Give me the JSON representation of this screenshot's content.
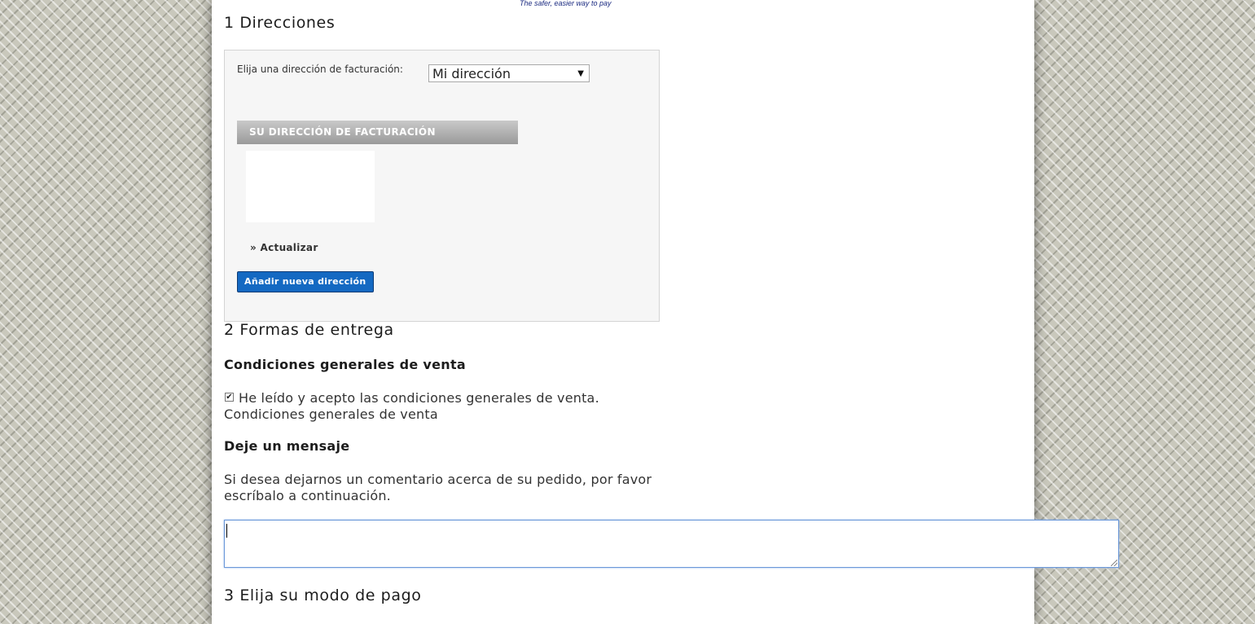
{
  "header": {
    "paypal_tagline": "The safer, easier way to pay"
  },
  "step1": {
    "title": "1 Direcciones",
    "billing_label": "Elija una dirección de facturación:",
    "billing_select_value": "Mi dirección",
    "billing_header": "SU DIRECCIÓN DE FACTURACIÓN",
    "update_link": "» Actualizar",
    "add_address_button": "Añadir nueva dirección"
  },
  "step2": {
    "title": "2 Formas de entrega",
    "terms_heading": "Condiciones generales de venta",
    "terms_checkbox_label": "He leído y acepto las condiciones generales de venta.",
    "terms_checked": true,
    "terms_link": "Condiciones generales de venta",
    "message_heading": "Deje un mensaje",
    "message_line1": "Si desea dejarnos un comentario acerca de su pedido, por favor",
    "message_line2": "escríbalo a continuación.",
    "message_value": ""
  },
  "step3": {
    "title": "3 Elija su modo de pago"
  },
  "colors": {
    "button_blue": "#1469c2",
    "section_header_gray": "#9a9a9a",
    "page_background": "#ffffff"
  }
}
